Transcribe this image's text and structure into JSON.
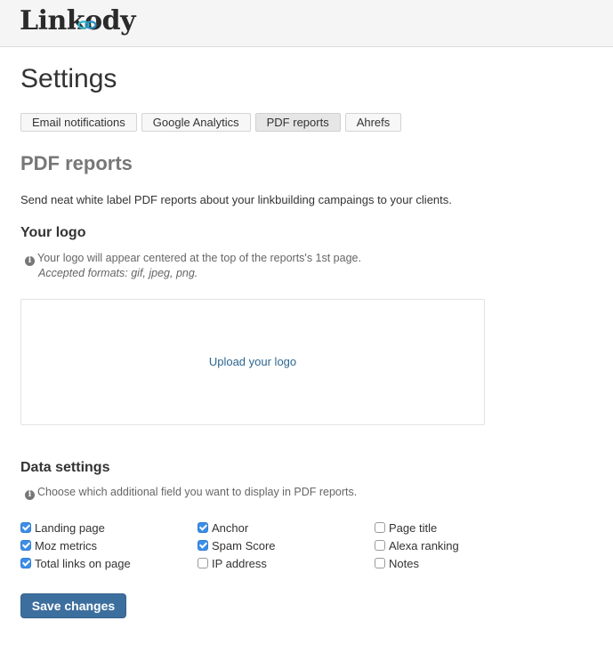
{
  "brand": {
    "name": "Linkody"
  },
  "page": {
    "title": "Settings"
  },
  "tabs": [
    {
      "label": "Email notifications",
      "active": false
    },
    {
      "label": "Google Analytics",
      "active": false
    },
    {
      "label": "PDF reports",
      "active": true
    },
    {
      "label": "Ahrefs",
      "active": false
    }
  ],
  "section": {
    "title": "PDF reports",
    "intro": "Send neat white label PDF reports about your linkbuilding campaings to your clients."
  },
  "logo_settings": {
    "heading": "Your logo",
    "hint": "Your logo will appear centered at the top of the reports's 1st page.",
    "formats": "Accepted formats: gif, jpeg, png.",
    "upload_label": "Upload your logo"
  },
  "data_settings": {
    "heading": "Data settings",
    "hint": "Choose which additional field you want to display in PDF reports.",
    "fields": [
      {
        "label": "Landing page",
        "checked": true
      },
      {
        "label": "Moz metrics",
        "checked": true
      },
      {
        "label": "Total links on page",
        "checked": true
      },
      {
        "label": "Anchor",
        "checked": true
      },
      {
        "label": "Spam Score",
        "checked": true
      },
      {
        "label": "IP address",
        "checked": false
      },
      {
        "label": "Page title",
        "checked": false
      },
      {
        "label": "Alexa ranking",
        "checked": false
      },
      {
        "label": "Notes",
        "checked": false
      }
    ]
  },
  "actions": {
    "save_label": "Save changes"
  },
  "colors": {
    "accent": "#3d6f9e",
    "checkbox": "#3d8ee6",
    "link": "#2d6690"
  },
  "icons": {
    "info": "info-circle-icon",
    "logo_link": "chain-link-icon"
  }
}
